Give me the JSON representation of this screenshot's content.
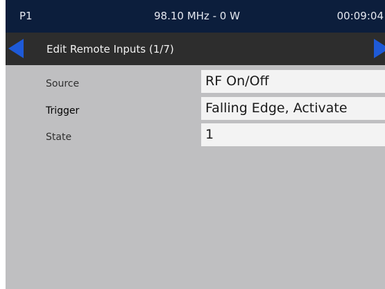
{
  "status_bar": {
    "preset": "P1",
    "frequency_power": "98.10 MHz - 0 W",
    "time": "00:09:04"
  },
  "title_bar": {
    "title": "Edit Remote Inputs (1/7)",
    "prev_icon": "arrow-left-icon",
    "next_icon": "arrow-right-icon"
  },
  "settings": [
    {
      "label": "Source",
      "value": "RF On/Off"
    },
    {
      "label": "Trigger",
      "value": "Falling Edge, Activate"
    },
    {
      "label": "State",
      "value": "1"
    }
  ],
  "colors": {
    "status_bar_bg": "#0c1e3c",
    "title_bar_bg": "#2d2d2d",
    "content_bg": "#bfbfc1",
    "field_bg": "#f3f3f3",
    "accent_arrow": "#1e5ad8"
  }
}
